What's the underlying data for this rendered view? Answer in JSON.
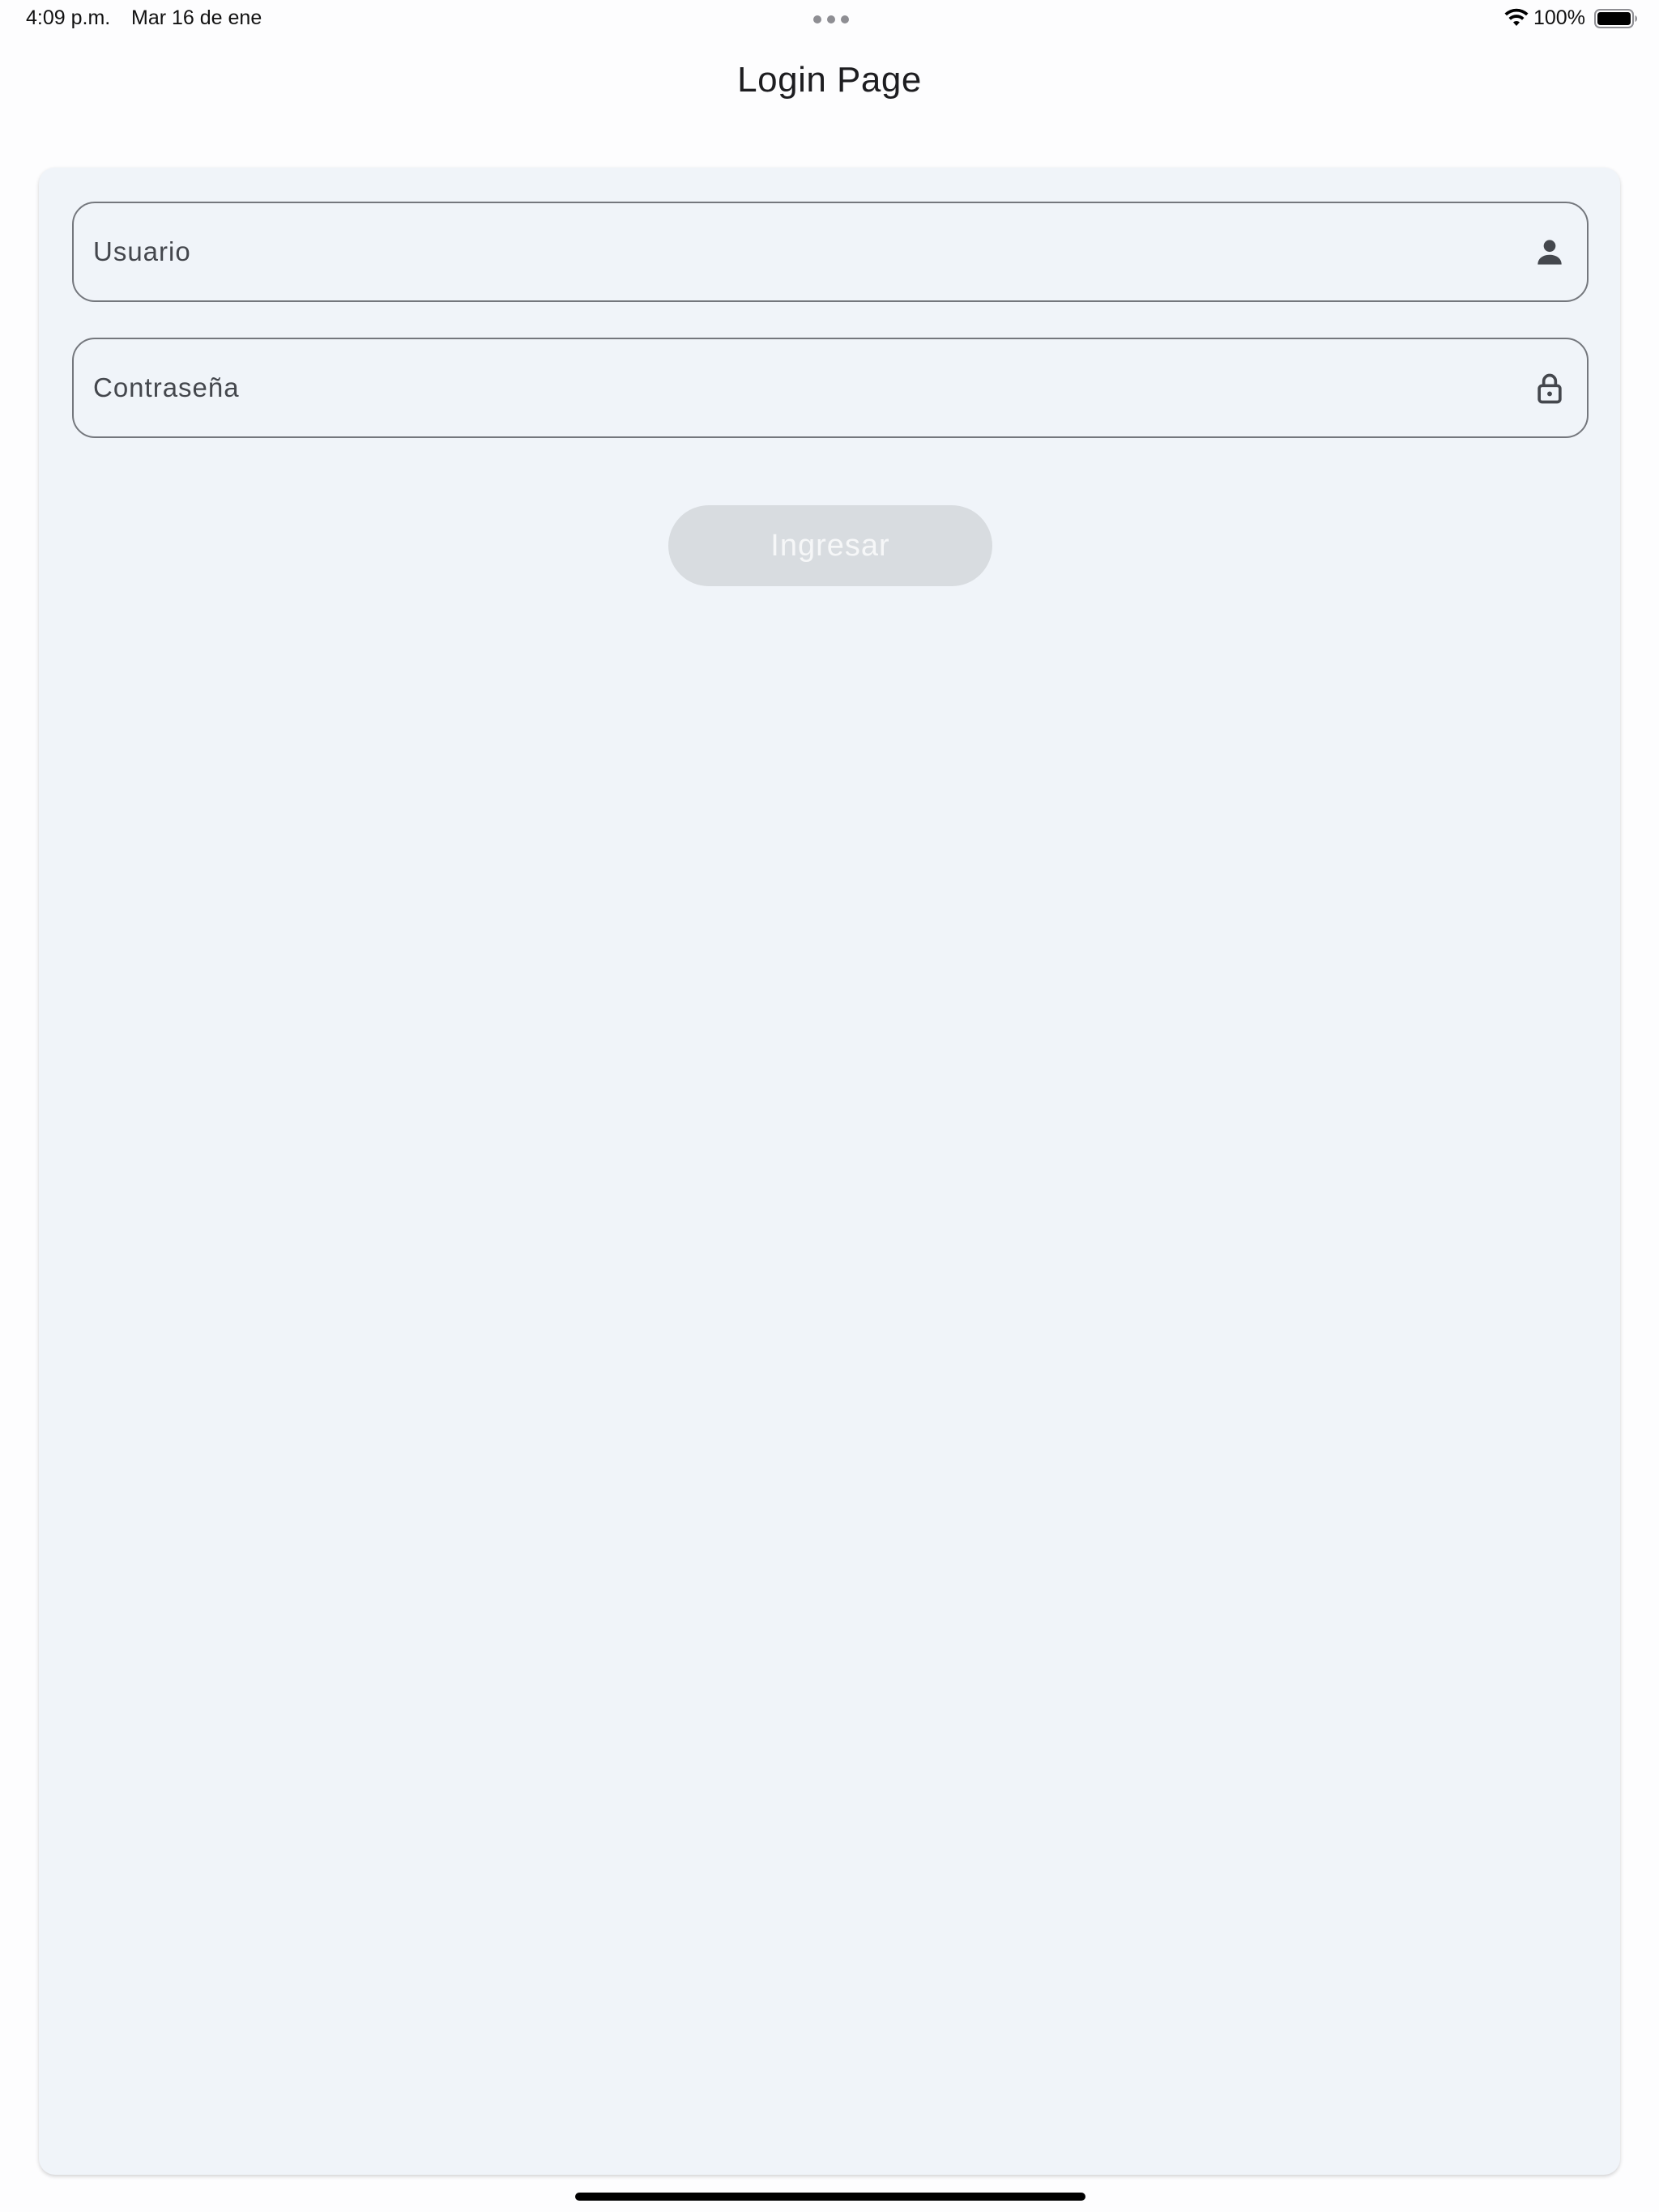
{
  "status_bar": {
    "time": "4:09 p.m.",
    "date": "Mar 16 de ene",
    "battery": "100%",
    "icons": [
      "multitask-dots-icon",
      "wifi-icon",
      "battery-icon"
    ]
  },
  "app_bar": {
    "title": "Login Page"
  },
  "form": {
    "username": {
      "placeholder": "Usuario",
      "icon": "person-icon"
    },
    "password": {
      "placeholder": "Contraseña",
      "icon": "lock-icon"
    },
    "submit_label": "Ingresar"
  },
  "colors": {
    "card_background": "#f0f4f9",
    "field_border": "#74777d",
    "button_disabled_background": "#d8dce0",
    "button_disabled_text": "#f6f7f8"
  }
}
